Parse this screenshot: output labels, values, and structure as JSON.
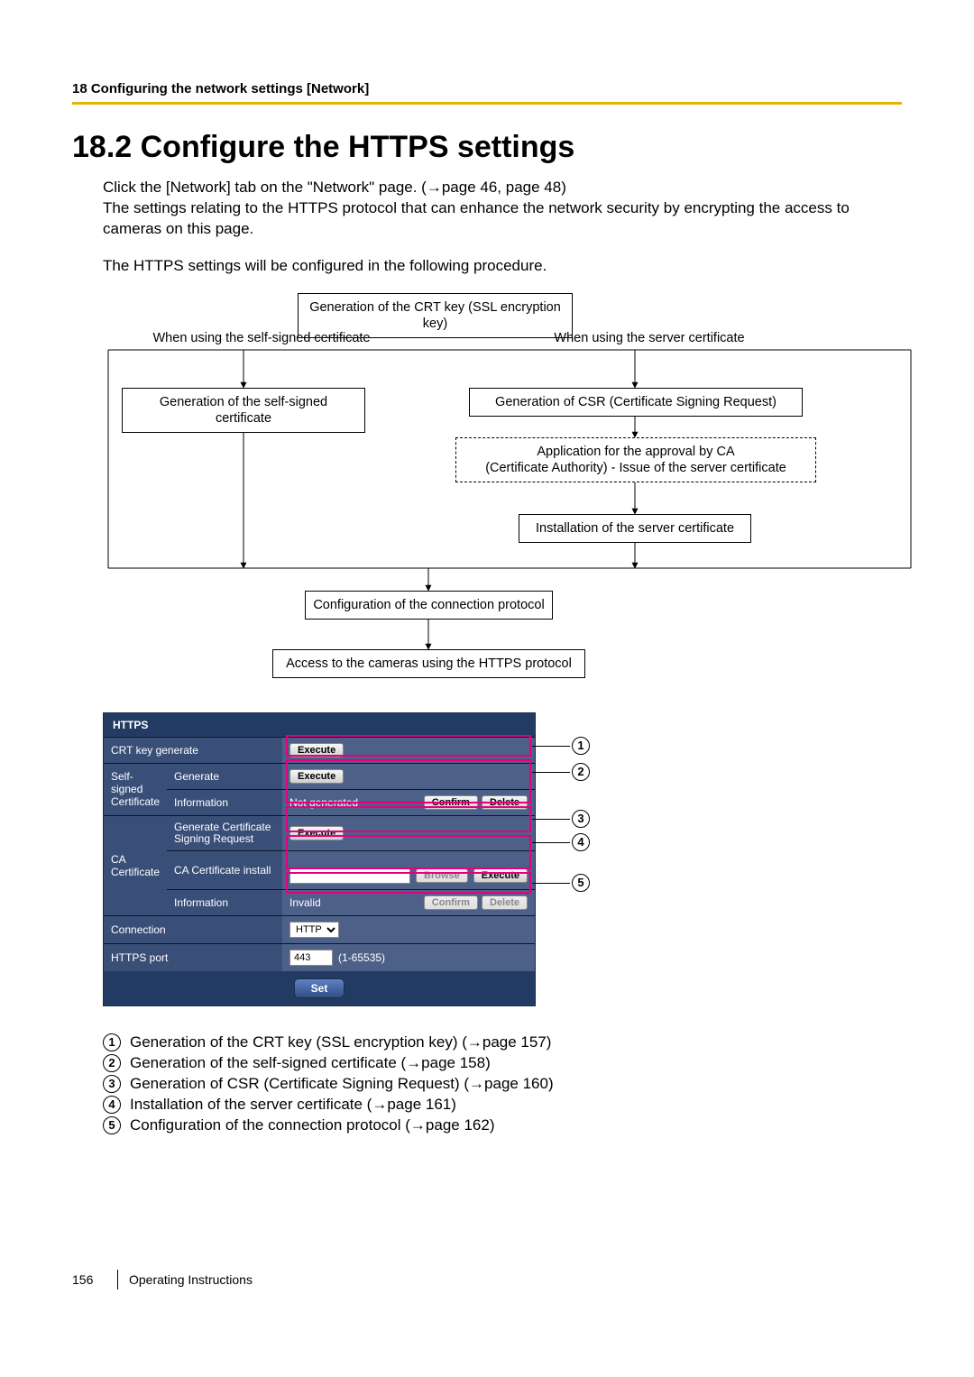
{
  "header": {
    "crumb": "18 Configuring the network settings [Network]"
  },
  "title": "18.2  Configure the HTTPS settings",
  "paras": {
    "p1a": "Click the [Network] tab on the \"Network\" page. (",
    "p1b": "page 46, page 48)",
    "p2": "The settings relating to the HTTPS protocol that can enhance the network security by encrypting the access to cameras on this page.",
    "p3": "The HTTPS settings will be configured in the following procedure."
  },
  "flow": {
    "b1": "Generation of the CRT key (SSL encryption key)",
    "l_left": "When using the self-signed certificate",
    "l_right": "When using the server certificate",
    "b2l": "Generation of the self-signed certificate",
    "b2r": "Generation of CSR (Certificate Signing Request)",
    "b3r": "Application for the approval by CA\n(Certificate Authority) - Issue of the server certificate",
    "b4r": "Installation of the server certificate",
    "b5": "Configuration of the connection protocol",
    "b6": "Access to the cameras using the HTTPS protocol"
  },
  "panel": {
    "hdr": "HTTPS",
    "rows": {
      "crt": "CRT key generate",
      "ss": "Self-signed Certificate",
      "ss_gen": "Generate",
      "ss_info": "Information",
      "ss_info_v": "Not generated",
      "ca": "CA Certificate",
      "ca_csr": "Generate Certificate Signing Request",
      "ca_inst": "CA Certificate install",
      "ca_info": "Information",
      "ca_info_v": "Invalid",
      "conn": "Connection",
      "conn_v": "HTTP",
      "port": "HTTPS port",
      "port_v": "443",
      "port_h": "(1-65535)"
    },
    "btn": {
      "exec": "Execute",
      "confirm": "Confirm",
      "delete": "Delete",
      "browse": "Browse",
      "set": "Set"
    }
  },
  "list": {
    "1": "Generation of the CRT key (SSL encryption key) (→page 157)",
    "2": "Generation of the self-signed certificate (→page 158)",
    "3": "Generation of CSR (Certificate Signing Request) (→page 160)",
    "4": "Installation of the server certificate (→page 161)",
    "5": "Configuration of the connection protocol (→page 162)"
  },
  "footer": {
    "pn": "156",
    "label": "Operating Instructions"
  }
}
